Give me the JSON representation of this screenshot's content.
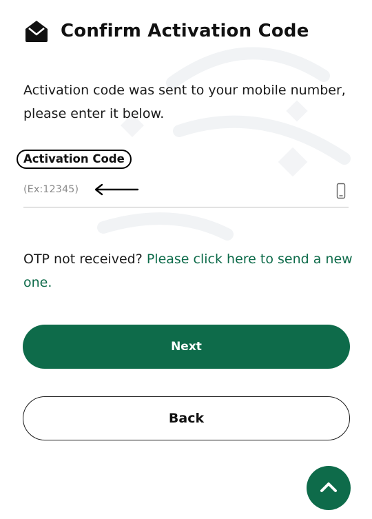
{
  "header": {
    "title": "Confirm Activation Code",
    "icon": "envelope-open-icon"
  },
  "info_text": "Activation code was sent to your mobile number, please enter it below.",
  "activation_field": {
    "label": "Activation Code",
    "value": "",
    "placeholder": "(Ex:12345)",
    "icon": "mobile-phone-icon",
    "annotation_icon": "left-arrow-icon"
  },
  "otp": {
    "prompt": "OTP not received?",
    "link_text": "Please click here to send a new one."
  },
  "buttons": {
    "next_label": "Next",
    "back_label": "Back",
    "scroll_top_icon": "chevron-up-icon"
  },
  "colors": {
    "primary": "#0e6b4a",
    "text": "#111111",
    "placeholder": "#8c8c8c"
  }
}
